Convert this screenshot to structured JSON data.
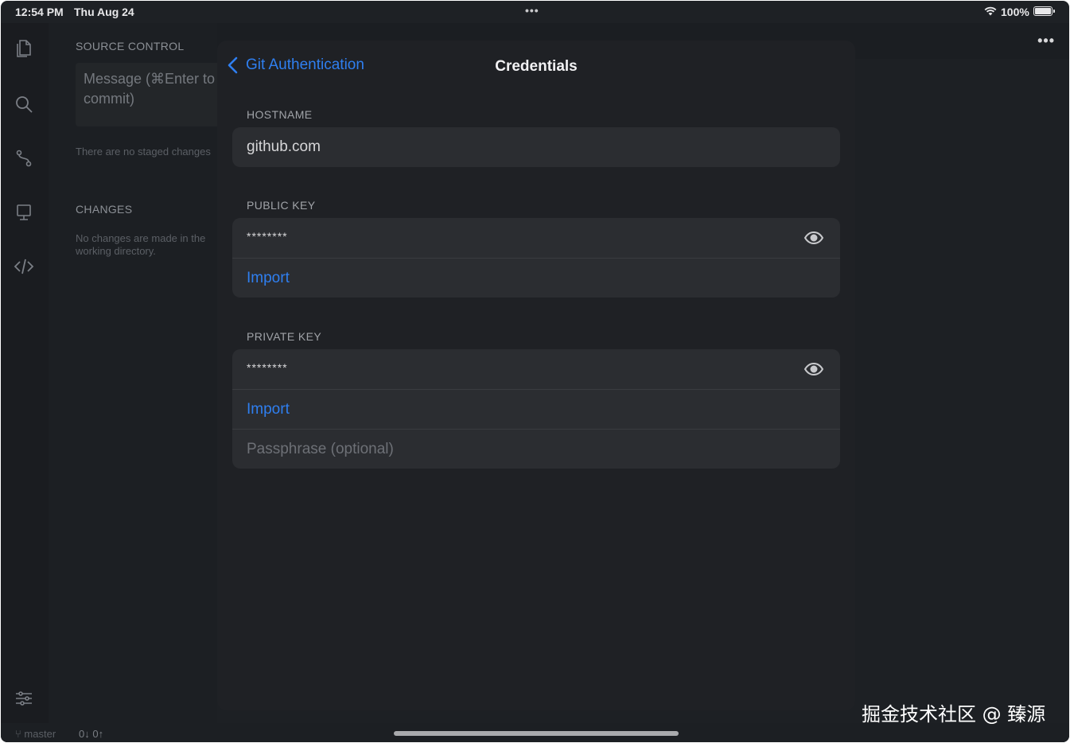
{
  "status_bar": {
    "time": "12:54 PM",
    "date": "Thu Aug 24",
    "multitask_dots": "•••",
    "battery_percent": "100%",
    "battery_level": 1.0
  },
  "activity_bar": {
    "icons": [
      "files-icon",
      "search-icon",
      "source-control-icon",
      "remote-icon",
      "code-icon",
      "settings-sliders-icon"
    ]
  },
  "sidebar": {
    "source_control_title": "SOURCE CONTROL",
    "commit_placeholder": "Message (⌘Enter to commit)",
    "staged_note": "There are no staged changes",
    "changes_title": "CHANGES",
    "changes_note": "No changes are made in the working directory."
  },
  "editor": {
    "more_label": "•••"
  },
  "sheet": {
    "back_label": "Git Authentication",
    "title": "Credentials",
    "hostname": {
      "label": "HOSTNAME",
      "value": "github.com"
    },
    "public_key": {
      "label": "PUBLIC KEY",
      "masked_value": "********",
      "import_label": "Import"
    },
    "private_key": {
      "label": "PRIVATE KEY",
      "masked_value": "********",
      "import_label": "Import",
      "passphrase_placeholder": "Passphrase (optional)"
    }
  },
  "bottom_bar": {
    "branch": "master",
    "sync": "0↓ 0↑"
  },
  "watermark": "掘金技术社区 @ 臻源",
  "colors": {
    "accent": "#2f7ff0",
    "background": "#1e2125",
    "sheet": "#1f2125",
    "group": "#2b2d31"
  }
}
